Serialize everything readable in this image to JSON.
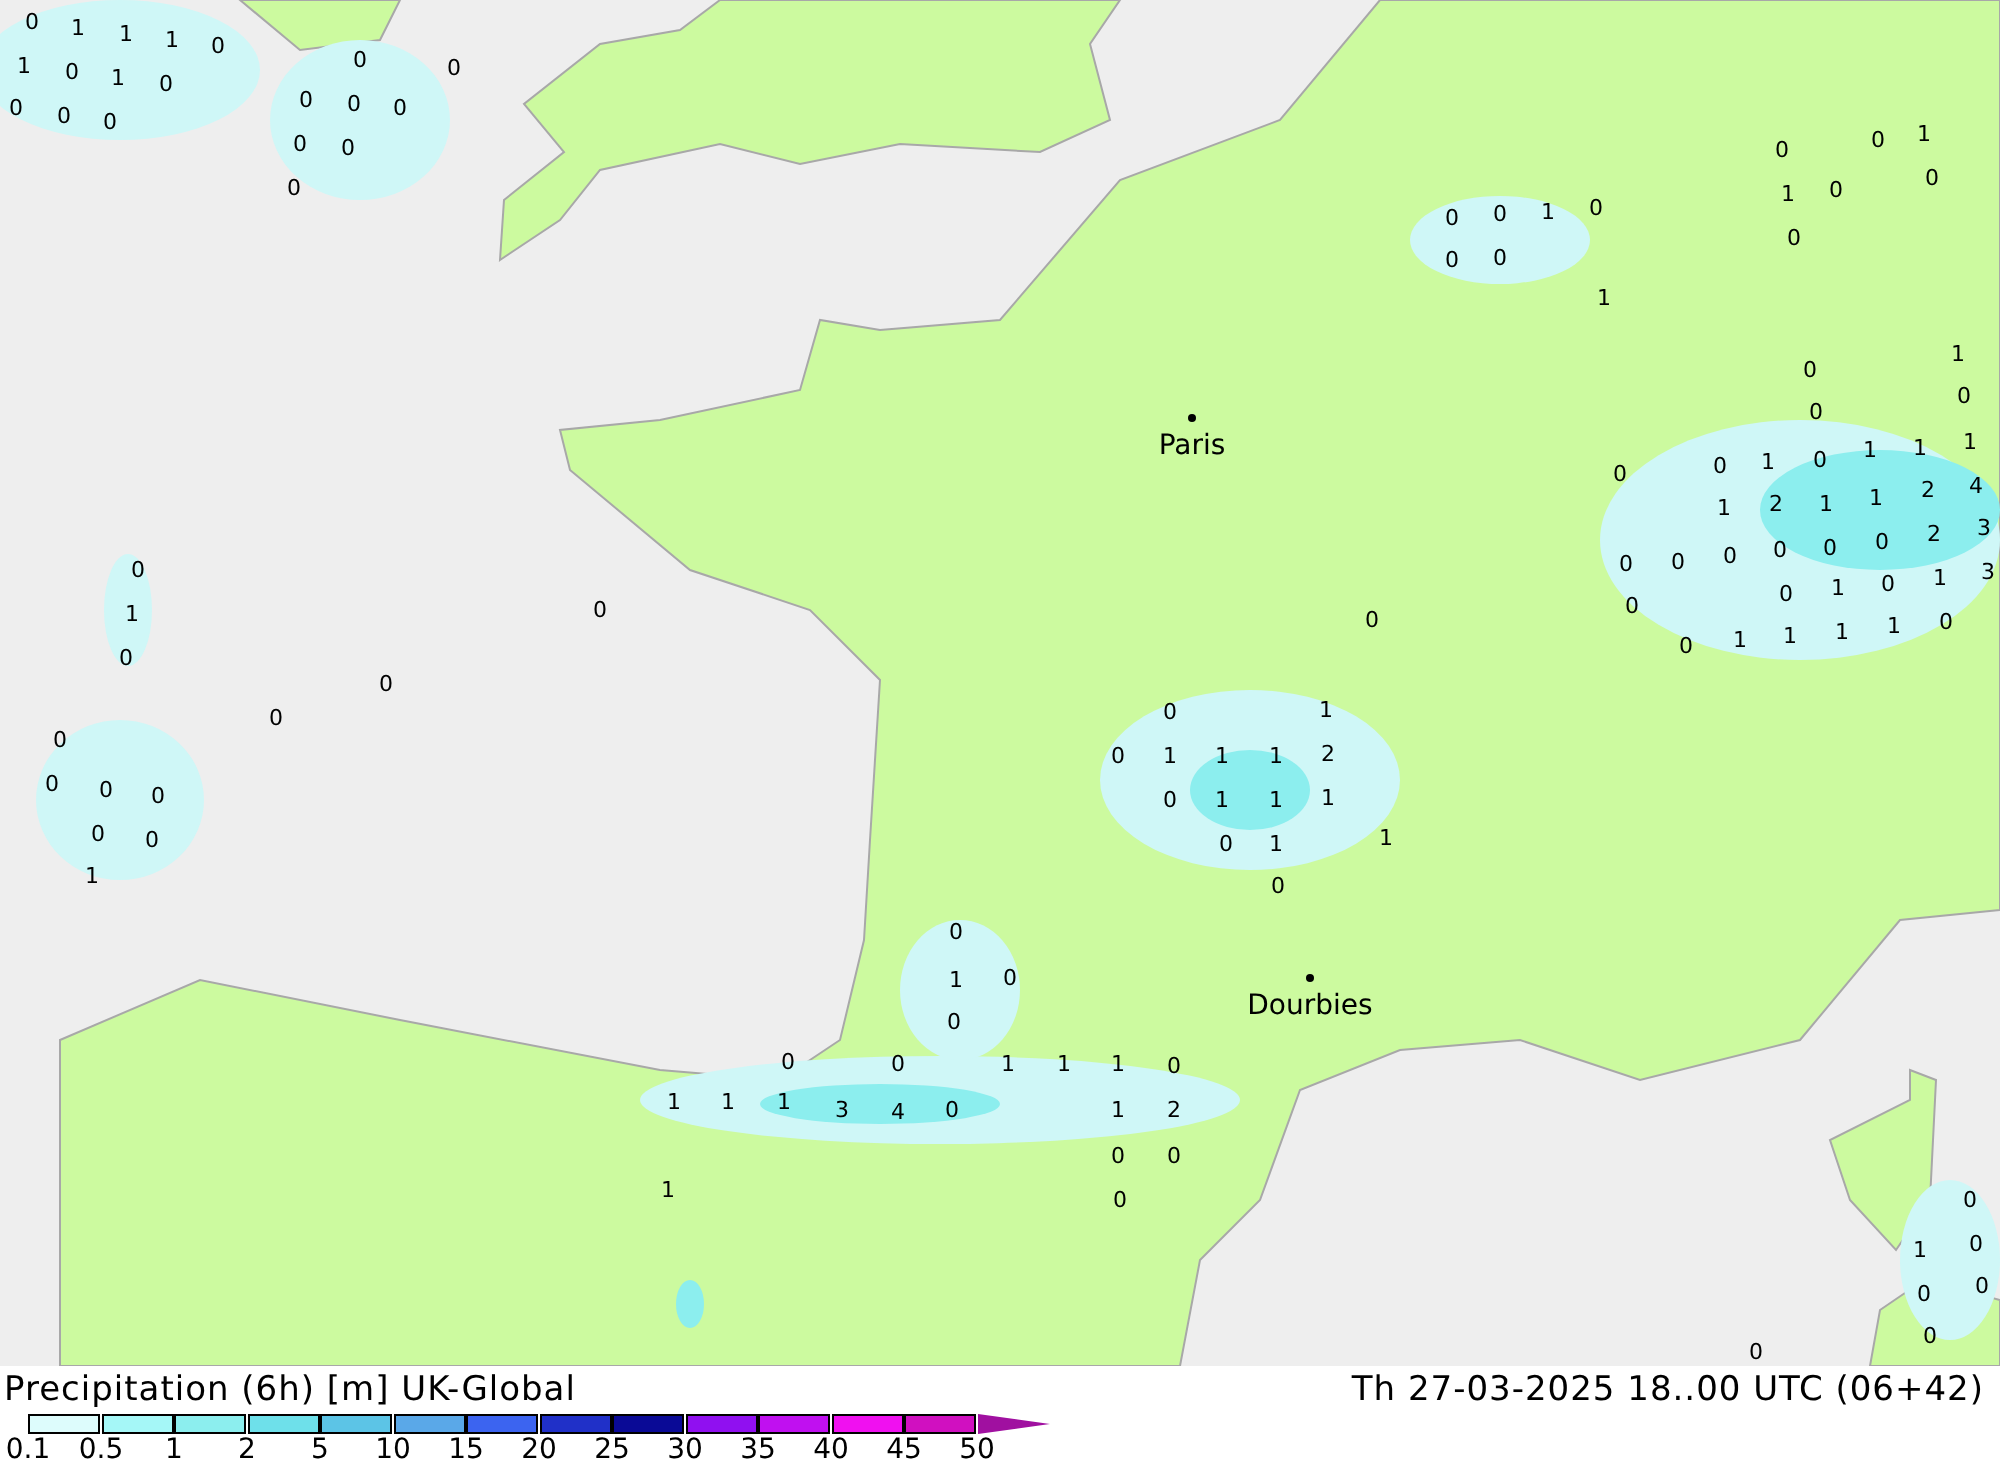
{
  "map": {
    "cities": [
      {
        "name": "Paris"
      },
      {
        "name": "Dourbies"
      }
    ],
    "value_labels": [
      "0",
      "1",
      "1",
      "1",
      "0",
      "1",
      "0",
      "1",
      "0",
      "0",
      "0",
      "0",
      "0",
      "0",
      "0",
      "0",
      "0",
      "0",
      "0",
      "0",
      "0",
      "1",
      "0",
      "0",
      "0",
      "0",
      "0",
      "0",
      "0",
      "1",
      "0",
      "0",
      "0",
      "0",
      "1",
      "0",
      "1",
      "1",
      "1",
      "2",
      "0",
      "1",
      "1",
      "1",
      "0",
      "1",
      "1",
      "0",
      "0",
      "0",
      "0",
      "1",
      "1",
      "0",
      "0",
      "0",
      "1",
      "0",
      "1",
      "0",
      "0",
      "0",
      "0",
      "1",
      "0",
      "0",
      "0",
      "0",
      "1",
      "0",
      "1",
      "1",
      "1",
      "0",
      "1",
      "2",
      "1",
      "1",
      "2",
      "4",
      "0",
      "0",
      "0",
      "0",
      "0",
      "0",
      "2",
      "3",
      "0",
      "0",
      "1",
      "0",
      "1",
      "3",
      "0",
      "1",
      "1",
      "1",
      "1",
      "0",
      "0",
      "1",
      "0",
      "0",
      "0",
      "0",
      "1",
      "1",
      "1",
      "0",
      "1",
      "1",
      "1",
      "3",
      "4",
      "0",
      "1",
      "2",
      "0",
      "0",
      "1",
      "0",
      "0",
      "0",
      "1",
      "0",
      "0",
      "0",
      "0"
    ]
  },
  "footer": {
    "title": "Precipitation (6h) [m] UK-Global",
    "valid_time": "Th 27-03-2025 18..00 UTC (06+42)",
    "legend": {
      "swatches": [
        {
          "color": "#ddfcfc"
        },
        {
          "color": "#a5f7f7"
        },
        {
          "color": "#8ceeee"
        },
        {
          "color": "#6ee0ea"
        },
        {
          "color": "#5cc4e6"
        },
        {
          "color": "#5aa8e8"
        },
        {
          "color": "#3c64f0"
        },
        {
          "color": "#2030c8"
        },
        {
          "color": "#0a0a96"
        },
        {
          "color": "#9010f0"
        },
        {
          "color": "#c010f0"
        },
        {
          "color": "#f010f0"
        },
        {
          "color": "#d010c0"
        }
      ],
      "labels": [
        "0.1",
        "0.5",
        "1",
        "2",
        "5",
        "10",
        "15",
        "20",
        "25",
        "30",
        "35",
        "40",
        "45",
        "50"
      ]
    }
  }
}
